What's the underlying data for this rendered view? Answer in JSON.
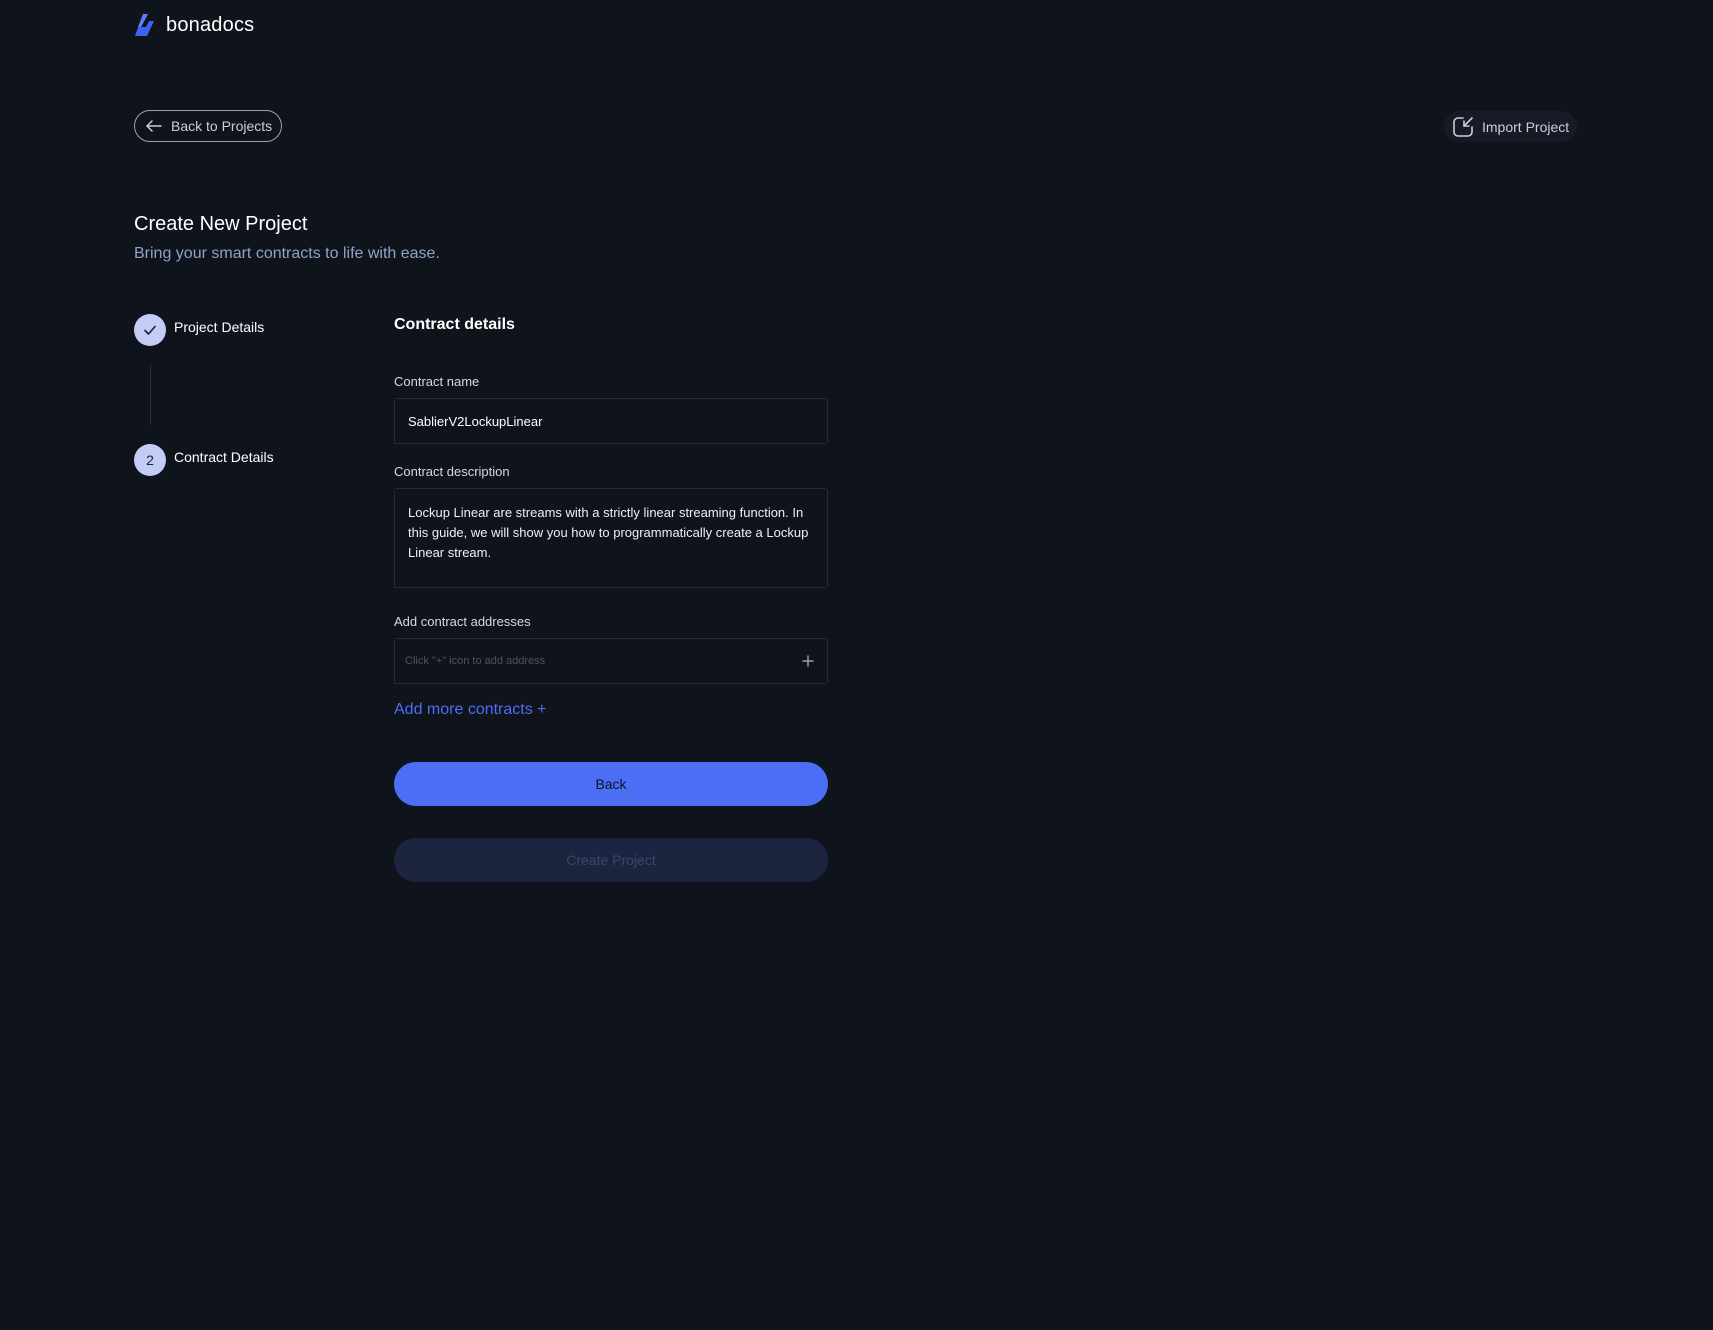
{
  "app": {
    "logo_text": "bonadocs",
    "logo_icon": "bonadocs-logo-icon"
  },
  "nav": {
    "back_label": "Back to Projects",
    "back_icon": "arrow-left-icon",
    "import_label": "Import Project",
    "import_icon": "import-icon"
  },
  "header": {
    "title": "Create New Project",
    "subtitle": "Bring your smart contracts to life with ease."
  },
  "steps": [
    {
      "label": "Project Details",
      "status": "complete",
      "icon": "check-icon"
    },
    {
      "label": "Contract Details",
      "number": "2",
      "status": "current"
    }
  ],
  "form": {
    "section_title": "Contract details",
    "name_label": "Contract name",
    "name_value": "SablierV2LockupLinear",
    "description_label": "Contract description",
    "description_value": "Lockup Linear are streams with a strictly linear streaming function. In this guide, we will show you how to programmatically create a Lockup Linear stream.",
    "addresses_label": "Add contract addresses",
    "addresses_placeholder": "Click \"+\" icon to add address",
    "add_more_label": "Add more contracts +",
    "back_button": "Back",
    "create_button": "Create Project"
  },
  "colors": {
    "background": "#0f131b",
    "accent": "#4c6ef5",
    "step_circle": "#c3cbf7",
    "disabled_button": "#1c2440"
  }
}
